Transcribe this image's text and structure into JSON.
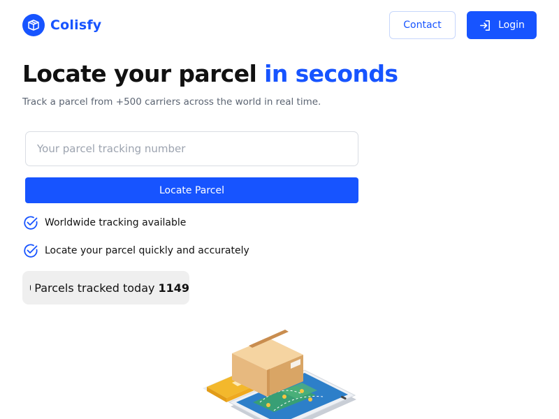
{
  "brand": {
    "name": "Colisfy"
  },
  "nav": {
    "contact_label": "Contact",
    "login_label": "Login"
  },
  "hero": {
    "title_main": "Locate your parcel",
    "title_accent": "in seconds",
    "subtitle": "Track a parcel from +500 carriers across the world in real time."
  },
  "search": {
    "placeholder": "Your parcel tracking number",
    "value": "",
    "button_label": "Locate Parcel"
  },
  "features": [
    {
      "label": "Worldwide tracking available",
      "icon": "check-circle-icon"
    },
    {
      "label": "Locate your parcel quickly and accurately",
      "icon": "check-circle-icon"
    }
  ],
  "stats": {
    "label": "Parcels tracked today",
    "value": "1149"
  },
  "colors": {
    "accent": "#1754ff",
    "counter_bg": "#efefef",
    "text_muted": "#5b6472"
  }
}
